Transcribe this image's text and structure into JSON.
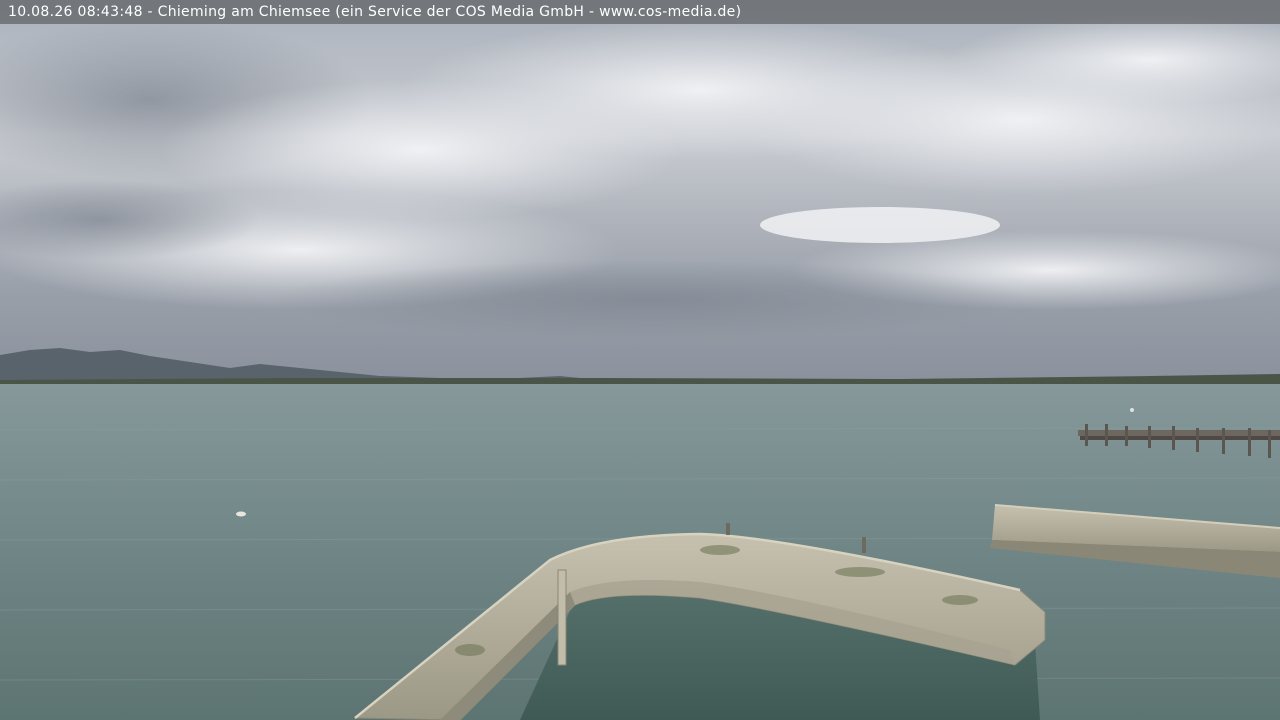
{
  "overlay": {
    "caption": "10.08.26 08:43:48 - Chieming am Chiemsee (ein Service der COS Media GmbH - www.cos-media.de)"
  },
  "colors": {
    "sky_top": "#b9bfc8",
    "sky_horizon": "#8a919c",
    "water_far": "#7f918f",
    "water_near": "#5f7775",
    "mountains": "#566068",
    "stone_light": "#bdb8a6",
    "stone_dark": "#7d7a6a",
    "pier_wood": "#5c5650"
  }
}
